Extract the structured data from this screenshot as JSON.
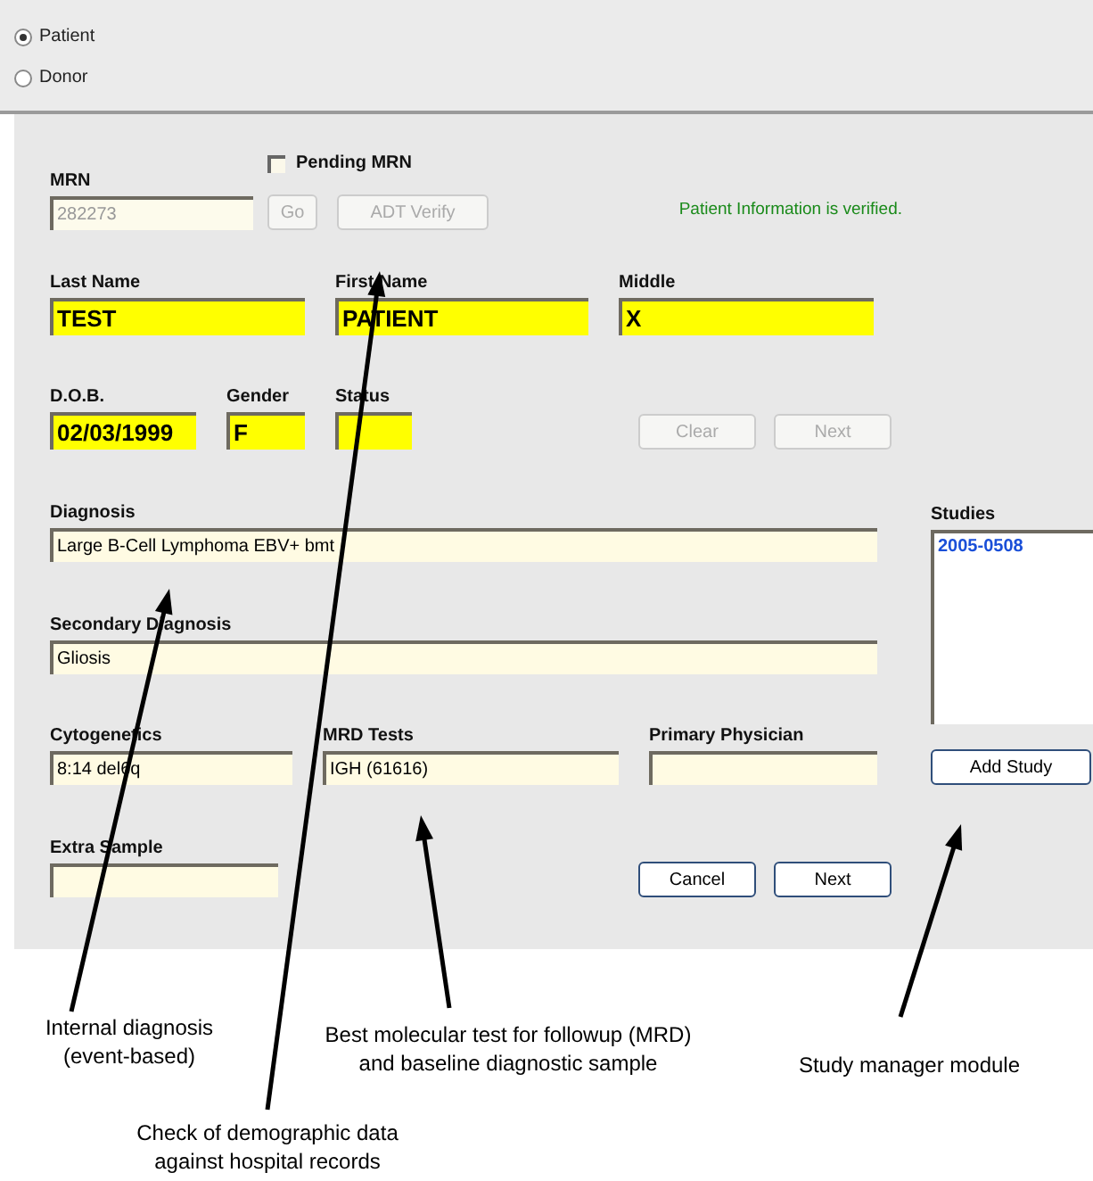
{
  "record_type": [
    {
      "label": "Patient",
      "selected": true
    },
    {
      "label": "Donor",
      "selected": false
    }
  ],
  "pending_mrn": {
    "label": "Pending MRN",
    "checked": false
  },
  "mrn": {
    "label": "MRN",
    "value": "282273",
    "disabled": true
  },
  "verify_buttons": [
    {
      "label": "Go",
      "disabled": true
    },
    {
      "label": "ADT Verify",
      "disabled": true
    }
  ],
  "verification_message": "Patient Information is verified.",
  "name_fields": [
    {
      "label": "Last Name",
      "value": "TEST",
      "highlighted": true
    },
    {
      "label": "First Name",
      "value": "PATIENT",
      "highlighted": true
    },
    {
      "label": "Middle",
      "value": "X",
      "highlighted": true
    }
  ],
  "demographic_fields": [
    {
      "label": "D.O.B.",
      "value": "02/03/1999",
      "highlighted": true
    },
    {
      "label": "Gender",
      "value": "F",
      "highlighted": true
    },
    {
      "label": "Status",
      "highlighted": true
    }
  ],
  "demographic_buttons": [
    {
      "label": "Clear",
      "disabled": true
    },
    {
      "label": "Next",
      "disabled": true
    }
  ],
  "diagnosis": {
    "label": "Diagnosis",
    "value": "Large B-Cell Lymphoma EBV+ bmt",
    "highlighted": false
  },
  "secondary_diagnosis": {
    "label": "Secondary Diagnosis",
    "value": "Gliosis",
    "highlighted": false
  },
  "test_fields": [
    {
      "label": "Cytogenetics",
      "value": "8:14 del6q",
      "highlighted": false
    },
    {
      "label": "MRD Tests",
      "value": "IGH (61616)",
      "highlighted": false
    },
    {
      "label": "Primary Physician",
      "highlighted": false
    }
  ],
  "extra_sample": {
    "label": "Extra Sample",
    "highlighted": false
  },
  "bottom_buttons": [
    {
      "label": "Cancel",
      "disabled": false
    },
    {
      "label": "Next",
      "disabled": false
    }
  ],
  "studies": {
    "label": "Studies",
    "items": [
      "2005-0508"
    ],
    "button": {
      "label": "Add Study",
      "disabled": false
    }
  },
  "annotations": [
    "Internal diagnosis\n(event-based)",
    "Check of demographic data\nagainst hospital records",
    "Best molecular test for followup (MRD)\nand baseline diagnostic sample",
    "Study manager module"
  ]
}
